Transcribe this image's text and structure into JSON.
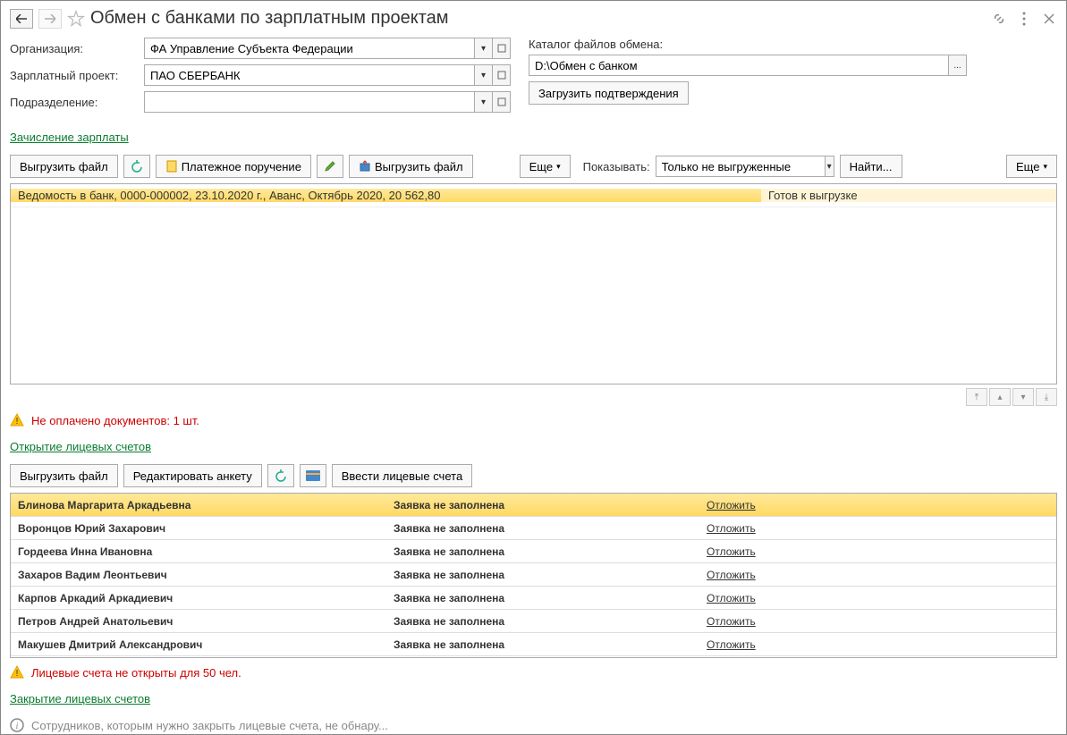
{
  "title": "Обмен с банками по зарплатным проектам",
  "form": {
    "org_label": "Организация:",
    "org_value": "ФА Управление Субъекта Федерации",
    "project_label": "Зарплатный проект:",
    "project_value": "ПАО СБЕРБАНК",
    "dept_label": "Подразделение:",
    "dept_value": "",
    "catalog_label": "Каталог файлов обмена:",
    "catalog_value": "D:\\Обмен с банком",
    "load_confirm_btn": "Загрузить подтверждения"
  },
  "section1": {
    "link": "Зачисление зарплаты",
    "btn_export": "Выгрузить файл",
    "btn_payment": "Платежное поручение",
    "btn_export2": "Выгрузить файл",
    "btn_more": "Еще",
    "show_label": "Показывать:",
    "show_value": "Только не выгруженные",
    "btn_find": "Найти...",
    "btn_more2": "Еще",
    "row": {
      "desc": "Ведомость в банк, 0000-000002, 23.10.2020 г., Аванс, Октябрь 2020, 20 562,80",
      "status": "Готов к выгрузке"
    },
    "warning": "Не оплачено документов: 1 шт."
  },
  "section2": {
    "link": "Открытие лицевых счетов",
    "btn_export": "Выгрузить файл",
    "btn_edit": "Редактировать анкету",
    "btn_enter": "Ввести лицевые счета",
    "rows": [
      {
        "name": "Блинова Маргарита Аркадьевна",
        "status": "Заявка не заполнена",
        "action": "Отложить"
      },
      {
        "name": "Воронцов Юрий Захарович",
        "status": "Заявка не заполнена",
        "action": "Отложить"
      },
      {
        "name": "Гордеева Инна Ивановна",
        "status": "Заявка не заполнена",
        "action": "Отложить"
      },
      {
        "name": "Захаров Вадим Леонтьевич",
        "status": "Заявка не заполнена",
        "action": "Отложить"
      },
      {
        "name": "Карпов Аркадий Аркадиевич",
        "status": "Заявка не заполнена",
        "action": "Отложить"
      },
      {
        "name": "Петров Андрей Анатольевич",
        "status": "Заявка не заполнена",
        "action": "Отложить"
      },
      {
        "name": "Макушев Дмитрий Александрович",
        "status": "Заявка не заполнена",
        "action": "Отложить"
      }
    ],
    "warning": "Лицевые счета не открыты для 50 чел."
  },
  "section3": {
    "link": "Закрытие лицевых счетов",
    "info": "Сотрудников, которым нужно закрыть лицевые счета, не обнару..."
  }
}
